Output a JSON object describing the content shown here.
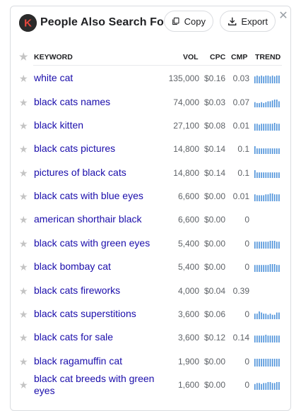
{
  "header": {
    "title": "People Also Search For",
    "logo_letter": "K",
    "copy_label": "Copy",
    "export_label": "Export",
    "close_label": "✕"
  },
  "columns": {
    "keyword": "KEYWORD",
    "vol": "VOL",
    "cpc": "CPC",
    "cmp": "CMP",
    "trend": "TREND"
  },
  "colors": {
    "link": "#1a0dab",
    "trend_bar": "#4a90d9",
    "star": "#c4c4c4"
  },
  "rows": [
    {
      "keyword": "white cat",
      "vol": "135,000",
      "cpc": "$0.16",
      "cmp": "0.03",
      "trend": [
        8,
        9,
        8,
        9,
        8,
        9,
        9,
        8,
        9,
        8,
        9,
        9
      ]
    },
    {
      "keyword": "black cats names",
      "vol": "74,000",
      "cpc": "$0.03",
      "cmp": "0.07",
      "trend": [
        6,
        5,
        5,
        6,
        5,
        6,
        7,
        7,
        8,
        9,
        9,
        7
      ]
    },
    {
      "keyword": "black kitten",
      "vol": "27,100",
      "cpc": "$0.08",
      "cmp": "0.01",
      "trend": [
        8,
        8,
        7,
        8,
        8,
        8,
        8,
        8,
        8,
        9,
        8,
        8
      ]
    },
    {
      "keyword": "black cats pictures",
      "vol": "14,800",
      "cpc": "$0.14",
      "cmp": "0.1",
      "trend": [
        7,
        5,
        5,
        5,
        5,
        5,
        5,
        5,
        5,
        5,
        5,
        5
      ]
    },
    {
      "keyword": "pictures of black cats",
      "vol": "14,800",
      "cpc": "$0.14",
      "cmp": "0.1",
      "trend": [
        7,
        5,
        5,
        5,
        5,
        5,
        5,
        5,
        5,
        5,
        5,
        5
      ]
    },
    {
      "keyword": "black cats with blue eyes",
      "vol": "6,600",
      "cpc": "$0.00",
      "cmp": "0.01",
      "trend": [
        8,
        7,
        7,
        7,
        7,
        8,
        8,
        9,
        9,
        8,
        8,
        8
      ]
    },
    {
      "keyword": "american shorthair black",
      "vol": "6,600",
      "cpc": "$0.00",
      "cmp": "0",
      "trend": []
    },
    {
      "keyword": "black cats with green eyes",
      "vol": "5,400",
      "cpc": "$0.00",
      "cmp": "0",
      "trend": [
        8,
        8,
        8,
        8,
        8,
        8,
        8,
        9,
        9,
        9,
        8,
        8
      ]
    },
    {
      "keyword": "black bombay cat",
      "vol": "5,400",
      "cpc": "$0.00",
      "cmp": "0",
      "trend": [
        8,
        8,
        8,
        8,
        8,
        8,
        8,
        9,
        9,
        9,
        8,
        8
      ]
    },
    {
      "keyword": "black cats fireworks",
      "vol": "4,000",
      "cpc": "$0.04",
      "cmp": "0.39",
      "trend": []
    },
    {
      "keyword": "black cats superstitions",
      "vol": "3,600",
      "cpc": "$0.06",
      "cmp": "0",
      "trend": [
        5,
        5,
        7,
        6,
        5,
        5,
        4,
        5,
        4,
        4,
        6,
        6
      ]
    },
    {
      "keyword": "black cats for sale",
      "vol": "3,600",
      "cpc": "$0.12",
      "cmp": "0.14",
      "trend": [
        8,
        8,
        8,
        8,
        8,
        9,
        8,
        8,
        8,
        8,
        8,
        8
      ]
    },
    {
      "keyword": "black ragamuffin cat",
      "vol": "1,900",
      "cpc": "$0.00",
      "cmp": "0",
      "trend": [
        8,
        8,
        8,
        8,
        8,
        8,
        8,
        8,
        8,
        8,
        8,
        8
      ]
    },
    {
      "keyword": "black cat breeds with green eyes",
      "vol": "1,600",
      "cpc": "$0.00",
      "cmp": "0",
      "trend": [
        6,
        7,
        7,
        6,
        7,
        7,
        8,
        8,
        7,
        7,
        8,
        8
      ]
    }
  ]
}
